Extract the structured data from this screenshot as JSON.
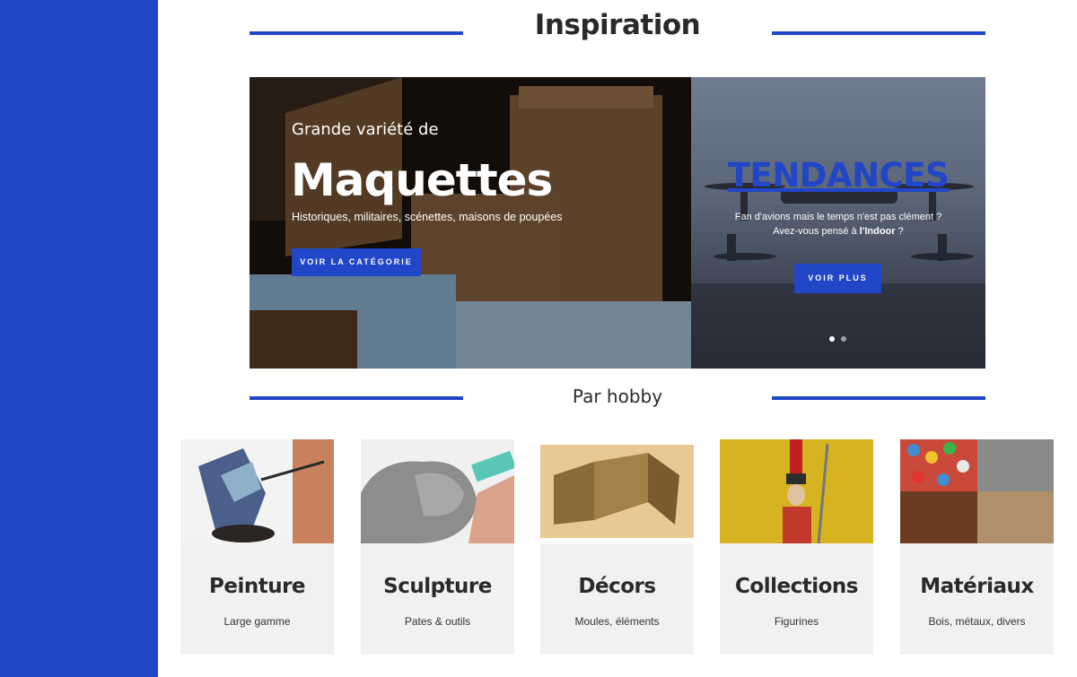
{
  "sections": {
    "inspiration_title": "Inspiration",
    "hobby_title": "Par hobby"
  },
  "banner": {
    "slide_a": {
      "eyebrow": "Grande variété de",
      "title": "Maquettes",
      "subtitle": "Historiques, militaires, scénettes, maisons de poupées",
      "button": "VOIR LA CATÉGORIE"
    },
    "slide_b": {
      "title": "TENDANCES",
      "line1": "Fan d'avions mais le temps n'est pas clément ?",
      "line2_prefix": "Avez-vous pensé à ",
      "line2_bold": "l'Indoor",
      "line2_suffix": " ?",
      "button": "VOIR PLUS"
    },
    "slide_count": 2,
    "active_slide": 1
  },
  "hobbies": [
    {
      "title": "Peinture",
      "subtitle": "Large gamme"
    },
    {
      "title": "Sculpture",
      "subtitle": "Pates & outils"
    },
    {
      "title": "Décors",
      "subtitle": "Moules, éléments"
    },
    {
      "title": "Collections",
      "subtitle": "Figurines"
    },
    {
      "title": "Matériaux",
      "subtitle": "Bois, métaux, divers"
    }
  ],
  "colors": {
    "accent": "#2146c7",
    "card_bg": "#f1f1f1",
    "heading": "#2a2a2a"
  }
}
